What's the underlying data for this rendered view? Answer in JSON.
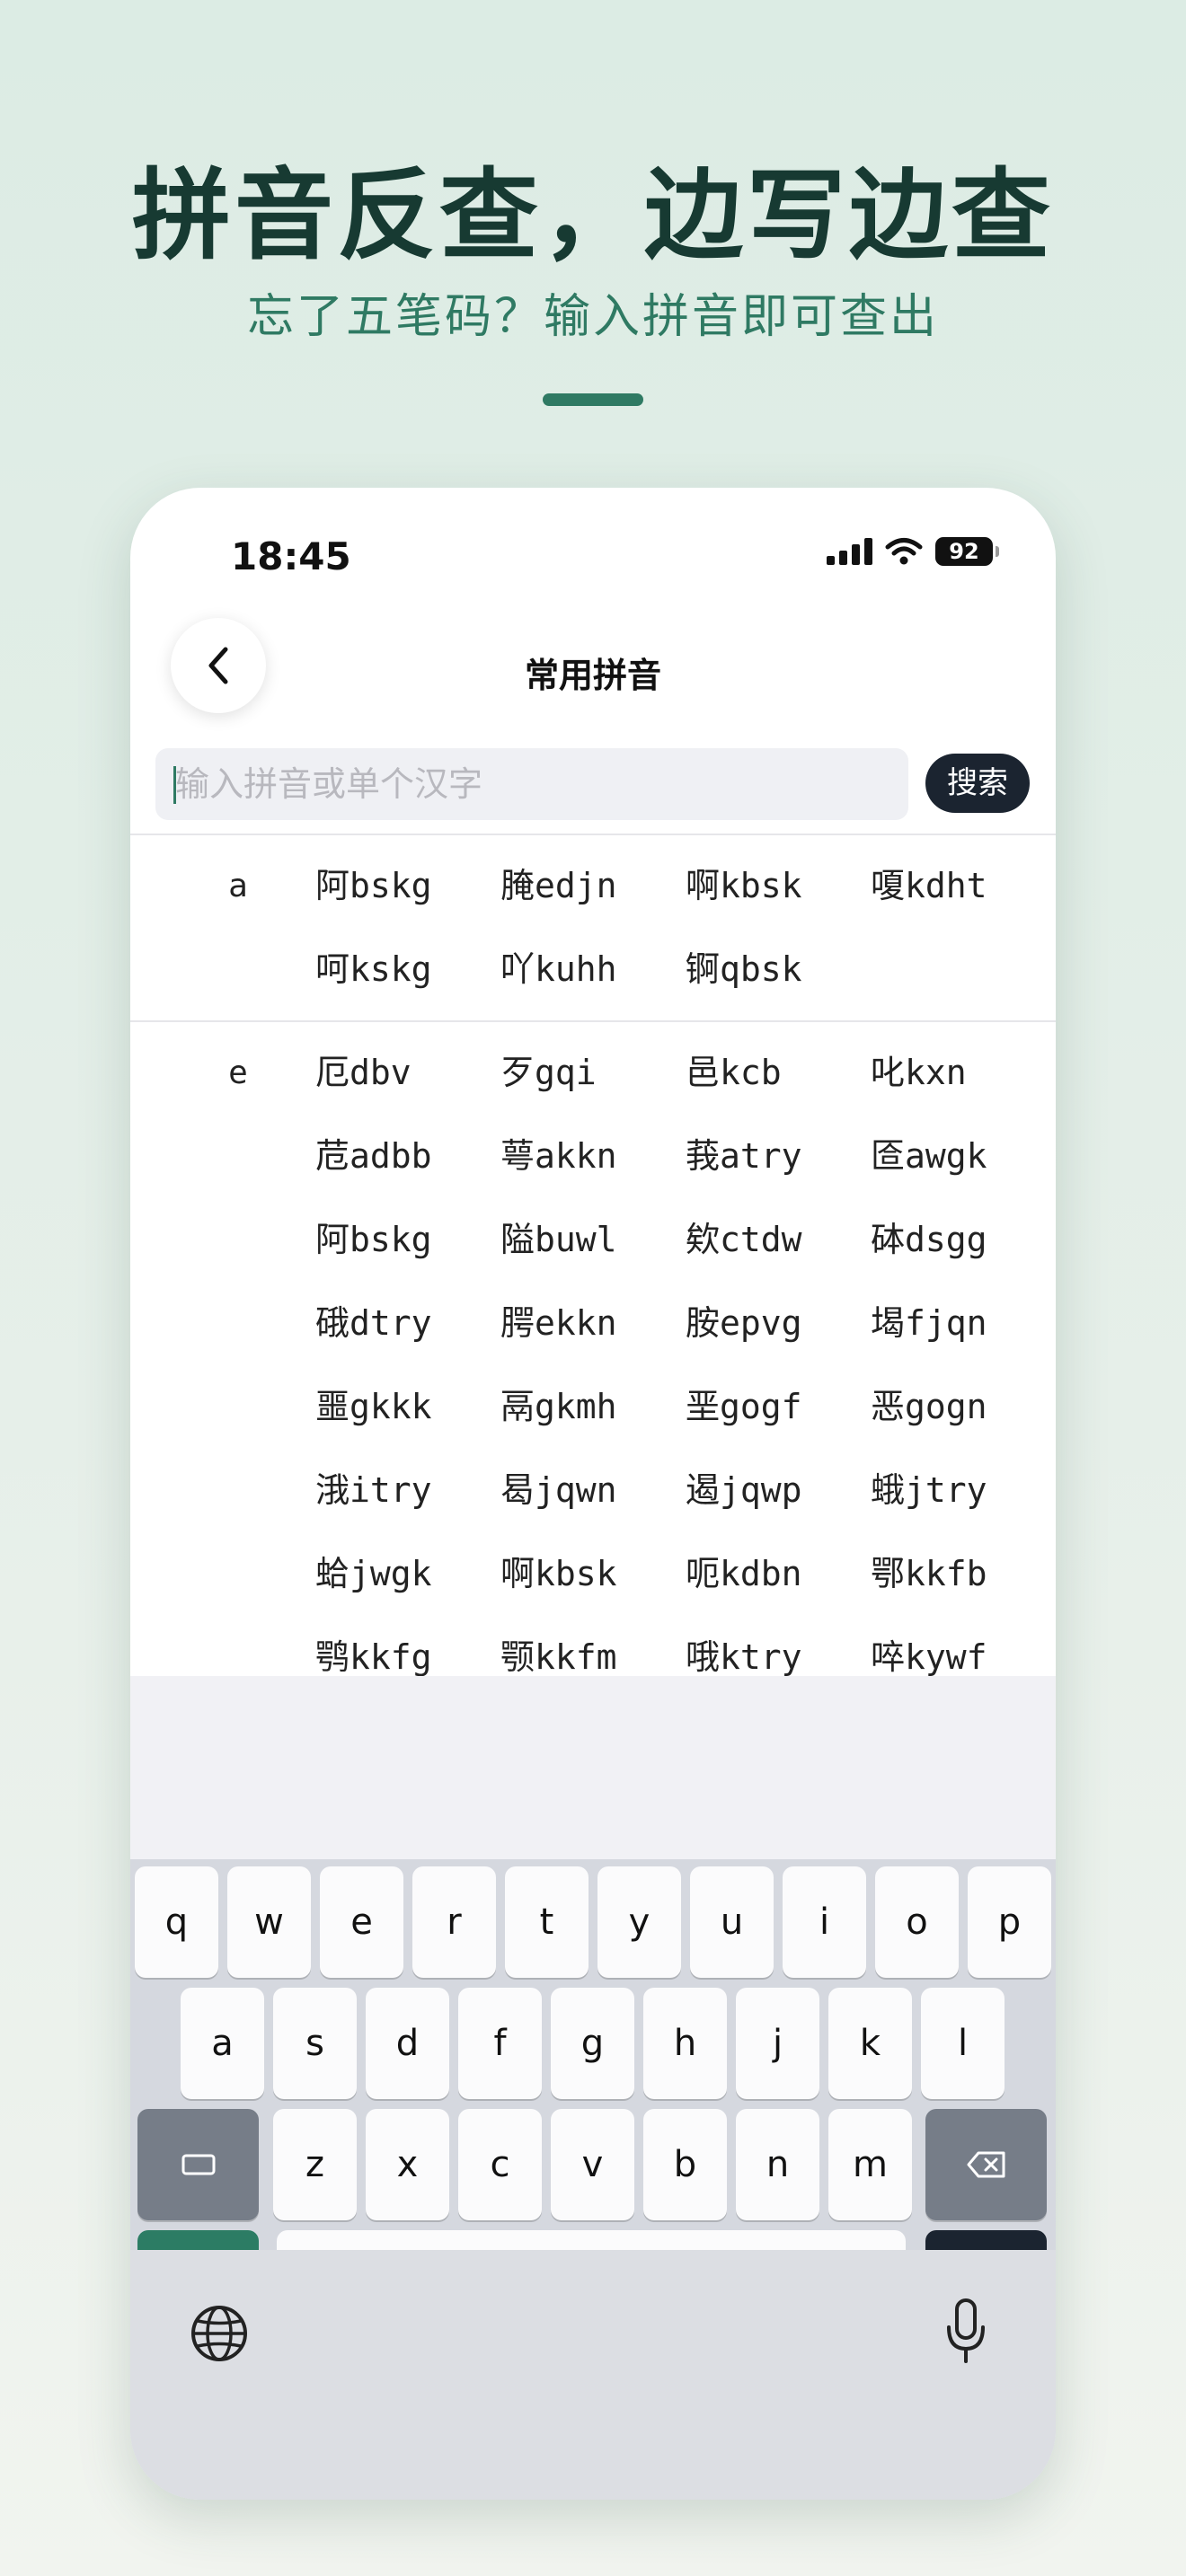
{
  "hero": {
    "title": "拼音反查，边写边查",
    "subtitle": "忘了五笔码？输入拼音即可查出"
  },
  "status_bar": {
    "time": "18:45",
    "battery": "92"
  },
  "nav": {
    "title": "常用拼音"
  },
  "search": {
    "placeholder": "输入拼音或单个汉字",
    "value": "",
    "button_label": "搜索"
  },
  "groups": [
    {
      "letter": "a",
      "rows": [
        [
          "阿bskg",
          "腌edjn",
          "啊kbsk",
          "嗄kdht"
        ],
        [
          "呵kskg",
          "吖kuhh",
          "锕qbsk"
        ]
      ]
    },
    {
      "letter": "e",
      "rows": [
        [
          "厄dbv",
          "歹gqi",
          "邑kcb",
          "叱kxn"
        ],
        [
          "苊adbb",
          "萼akkn",
          "莪atry",
          "匼awgk"
        ],
        [
          "阿bskg",
          "隘buwl",
          "欸ctdw",
          "砵dsgg"
        ],
        [
          "硪dtry",
          "腭ekkn",
          "胺epvg",
          "堨fjqn"
        ],
        [
          "噩gkkk",
          "鬲gkmh",
          "垩gogf",
          "恶gogn"
        ],
        [
          "涐itry",
          "曷jqwn",
          "遏jqwp",
          "蛾jtry"
        ],
        [
          "蛤jwgk",
          "啊kbsk",
          "呃kdbn",
          "鄂kkfb"
        ],
        [
          "鹗kkfg",
          "颚kkfm",
          "哦ktry",
          "啐kywf"
        ]
      ]
    }
  ],
  "keyboard": {
    "row1": [
      "q",
      "w",
      "e",
      "r",
      "t",
      "y",
      "u",
      "i",
      "o",
      "p"
    ],
    "row2": [
      "a",
      "s",
      "d",
      "f",
      "g",
      "h",
      "j",
      "k",
      "l"
    ],
    "row3": [
      "z",
      "x",
      "c",
      "v",
      "b",
      "n",
      "m"
    ],
    "shift_icon": "shift-rect-icon",
    "delete_icon": "backspace-icon",
    "plus_label": "+",
    "space_label": "␣",
    "return_label": "↵",
    "globe_icon": "globe-icon",
    "mic_icon": "microphone-icon"
  }
}
